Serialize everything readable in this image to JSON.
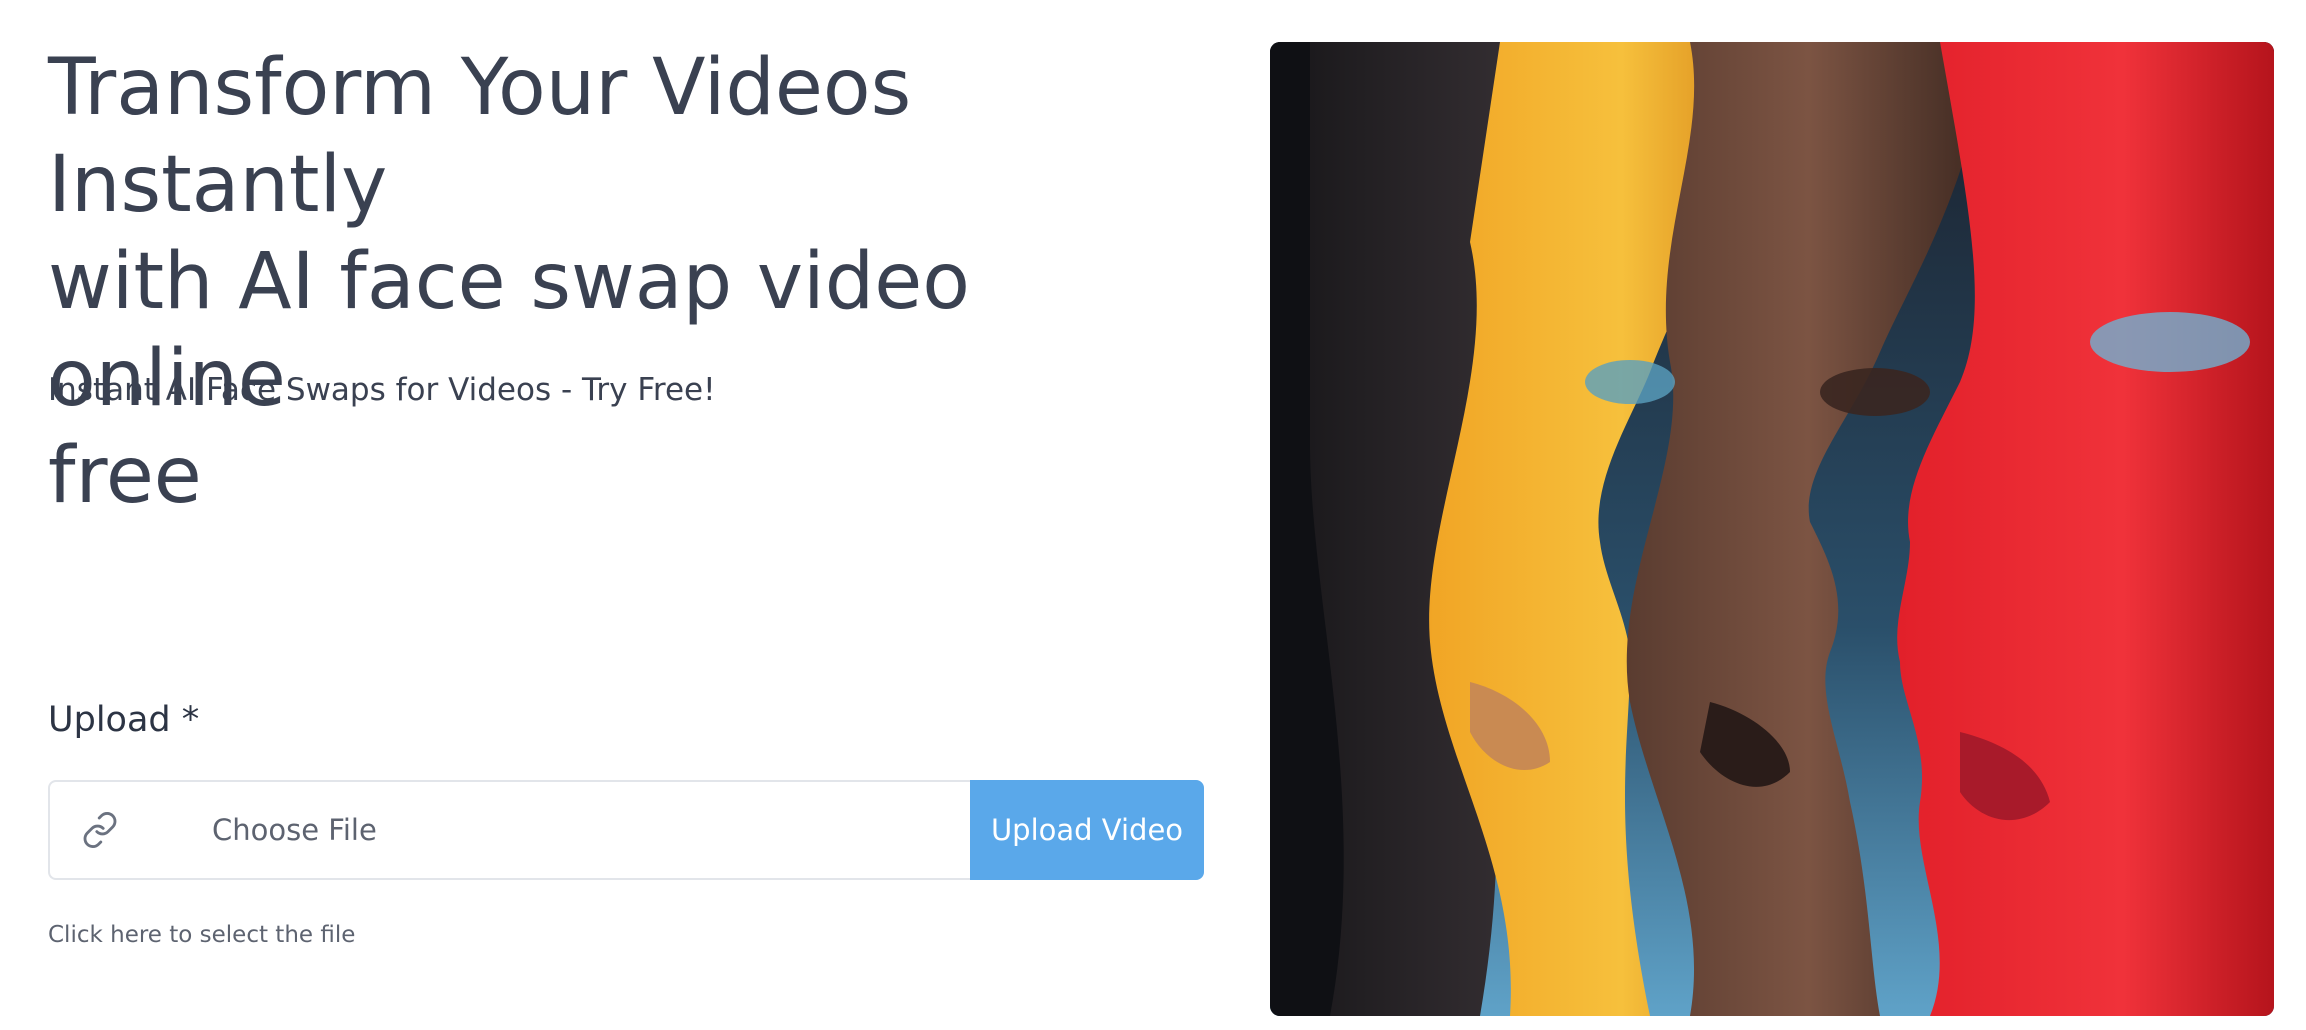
{
  "hero": {
    "title_lines": [
      "Transform Your Videos Instantly",
      "with AI face swap video online",
      "free"
    ],
    "subtitle": "Instant AI Face Swaps for Videos - Try Free!"
  },
  "upload": {
    "label": "Upload *",
    "icon": "link-icon",
    "file_placeholder": "Choose File",
    "button_label": "Upload Video",
    "helper": "Click here to select the file"
  },
  "colors": {
    "text_dark": "#3a4151",
    "button_blue": "#5aa8ea",
    "border": "#e2e5ea"
  },
  "image": {
    "subject": "four faces in profile painted dark, yellow, natural and red"
  }
}
